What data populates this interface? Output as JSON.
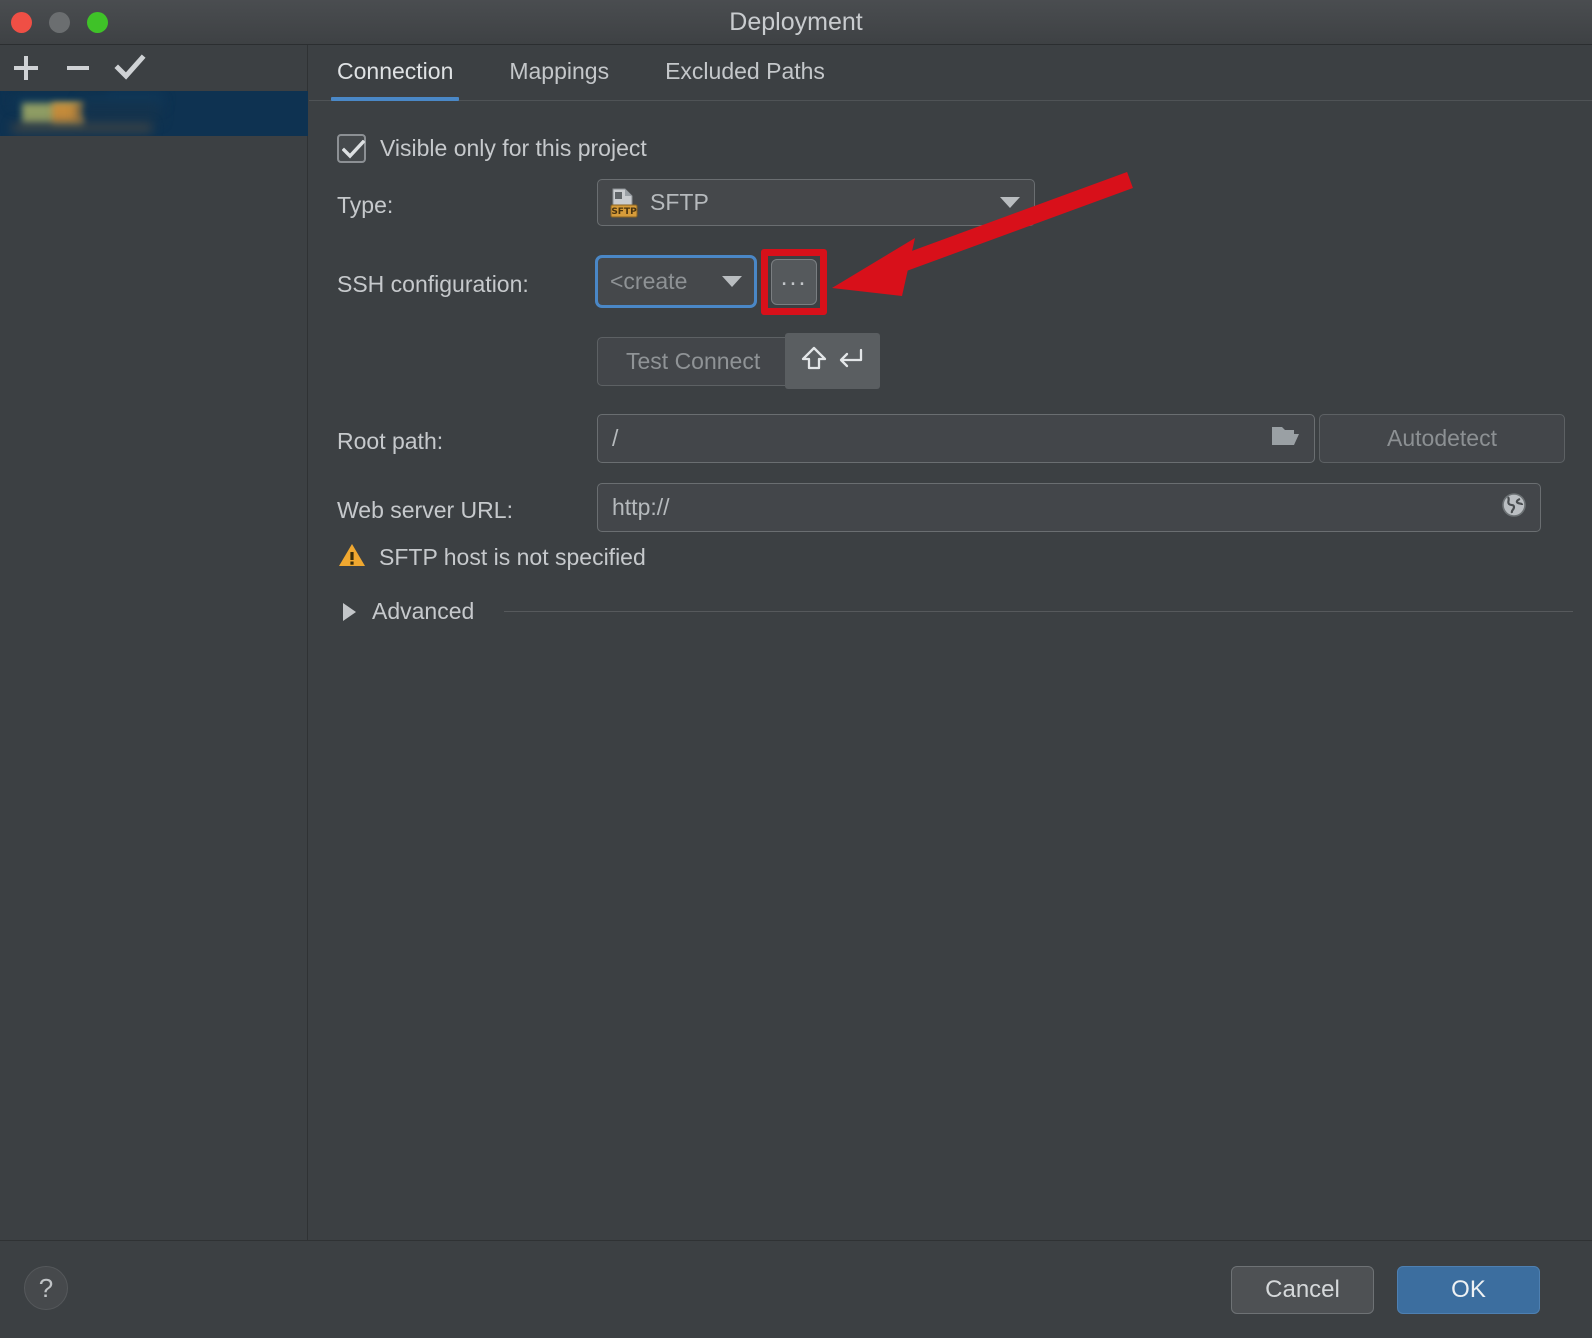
{
  "window": {
    "title": "Deployment",
    "traffic_lights": [
      "close-button",
      "minimize-button",
      "zoom-button"
    ]
  },
  "sidebar": {
    "toolbar": [
      {
        "name": "add-button",
        "glyph": "+"
      },
      {
        "name": "remove-button",
        "glyph": "−"
      },
      {
        "name": "set-default-button",
        "glyph": "✓"
      }
    ],
    "items": [
      {
        "label": "",
        "selected": true,
        "redacted": true
      }
    ]
  },
  "tabs": [
    {
      "label": "Connection",
      "active": true
    },
    {
      "label": "Mappings",
      "active": false
    },
    {
      "label": "Excluded Paths",
      "active": false
    }
  ],
  "form": {
    "visible_only_checkbox": {
      "label": "Visible only for this project",
      "checked": true
    },
    "type": {
      "label": "Type:",
      "value": "SFTP",
      "icon": "sftp-file-icon",
      "icon_badge": "SFTP"
    },
    "ssh_configuration": {
      "label": "SSH configuration:",
      "value": "<create",
      "browse_button_label": "...",
      "focused": true,
      "highlighted": true
    },
    "test_connection": {
      "label": "Test Connect",
      "full_label": "Test Connection",
      "enabled": false
    },
    "tooltip": {
      "shift_glyph": "⇧",
      "enter_glyph": "↵"
    },
    "root_path": {
      "label": "Root path:",
      "value": "/",
      "icon": "folder-icon"
    },
    "autodetect": {
      "label": "Autodetect",
      "enabled": false
    },
    "web_server_url": {
      "label": "Web server URL:",
      "value": "http://",
      "icon": "globe-icon"
    },
    "warning": {
      "icon": "warning-triangle-icon",
      "text": "SFTP host is not specified"
    },
    "advanced": {
      "label": "Advanced",
      "expanded": false
    }
  },
  "footer": {
    "help_label": "?",
    "cancel_label": "Cancel",
    "ok_label": "OK"
  },
  "annotation": {
    "arrow_color": "#d8101a",
    "highlight_color": "#d8101a",
    "target": "ssh-configuration-browse-button"
  },
  "colors": {
    "accent": "#4a88c7",
    "background": "#3c4043",
    "selection": "#0e3251",
    "warning": "#f0a830",
    "annotation": "#d8101a"
  }
}
